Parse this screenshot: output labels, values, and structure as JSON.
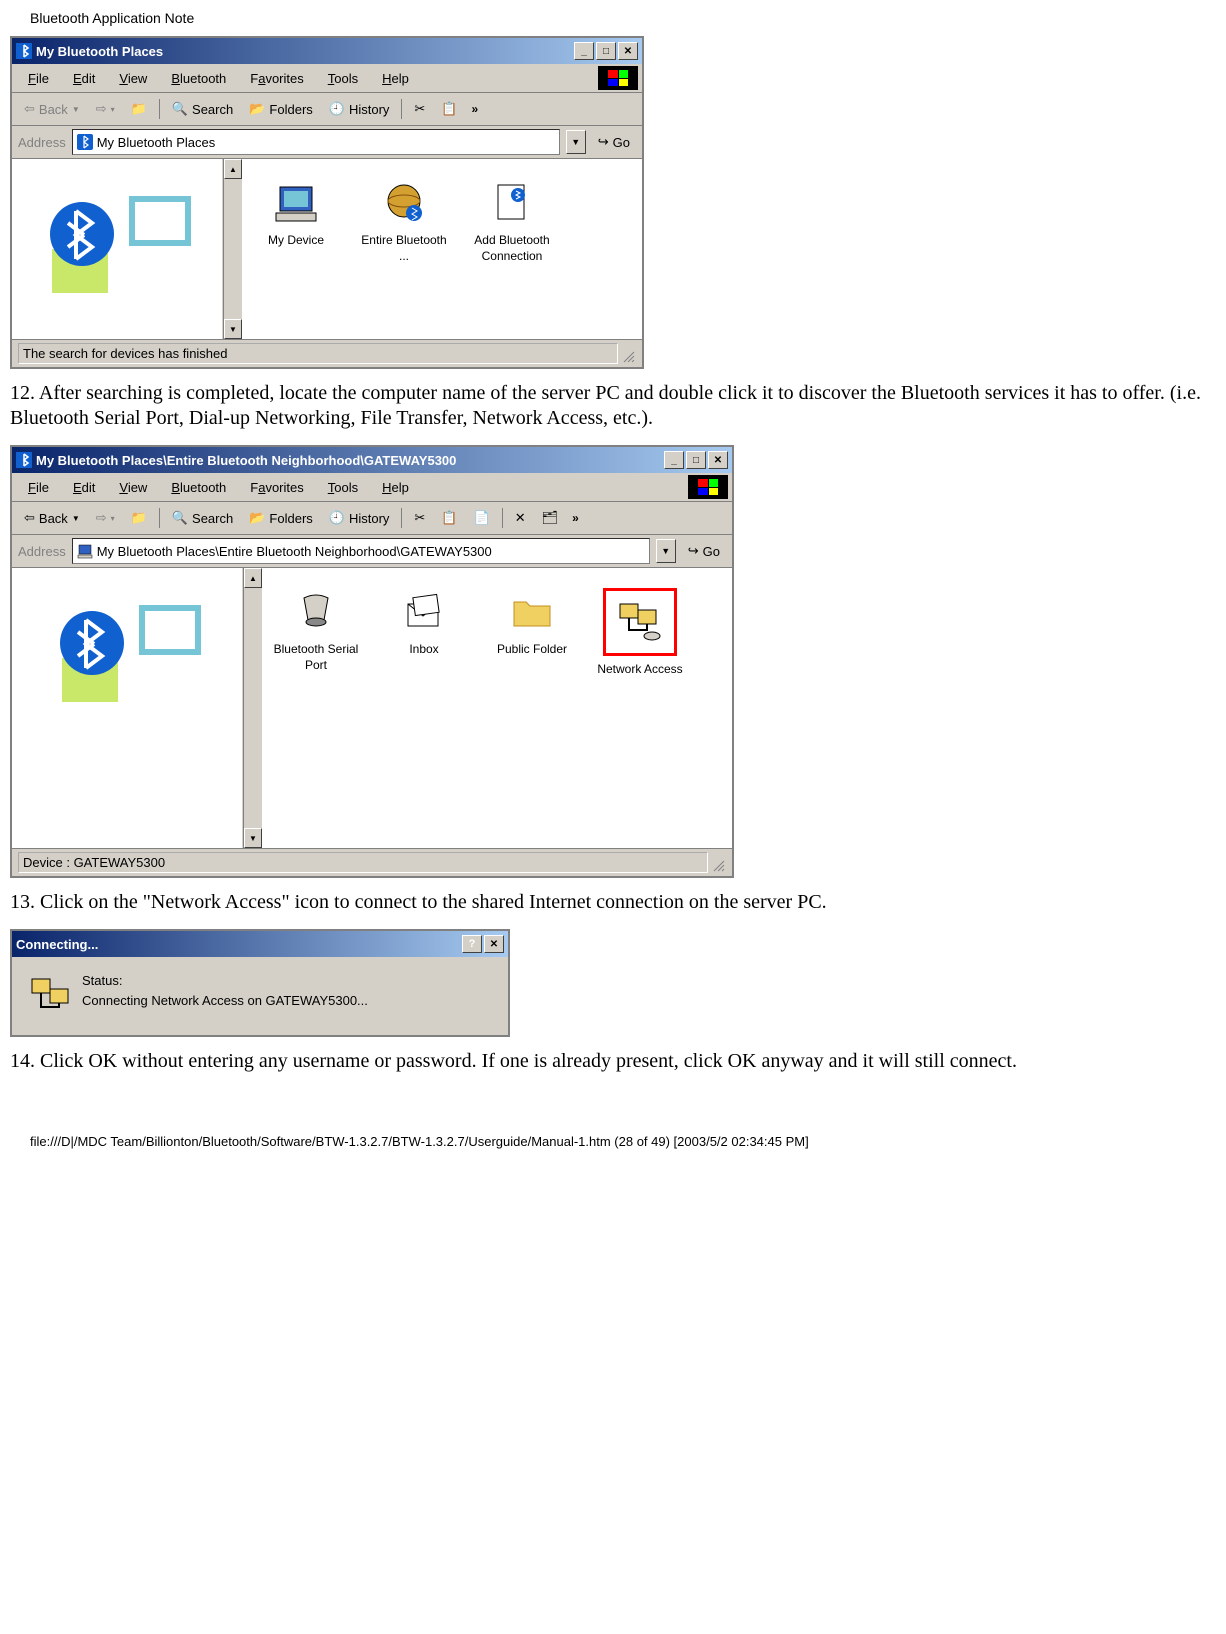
{
  "page_header": "Bluetooth Application Note",
  "win1": {
    "title": "My Bluetooth Places",
    "menus": [
      "File",
      "Edit",
      "View",
      "Bluetooth",
      "Favorites",
      "Tools",
      "Help"
    ],
    "back": "Back",
    "search": "Search",
    "folders": "Folders",
    "history": "History",
    "addr_label": "Address",
    "addr_value": "My Bluetooth Places",
    "go": "Go",
    "icons": [
      "My Device",
      "Entire Bluetooth ...",
      "Add Bluetooth Connection"
    ],
    "status": "The search for devices has finished"
  },
  "step12": "12. After searching is completed, locate the computer name of the server PC and double click it to discover the Bluetooth services it has to offer. (i.e. Bluetooth Serial Port, Dial-up Networking, File Transfer, Network Access, etc.).",
  "win2": {
    "title": "My Bluetooth Places\\Entire Bluetooth Neighborhood\\GATEWAY5300",
    "menus": [
      "File",
      "Edit",
      "View",
      "Bluetooth",
      "Favorites",
      "Tools",
      "Help"
    ],
    "back": "Back",
    "search": "Search",
    "folders": "Folders",
    "history": "History",
    "addr_label": "Address",
    "addr_value": "My Bluetooth Places\\Entire Bluetooth Neighborhood\\GATEWAY5300",
    "go": "Go",
    "icons": [
      "Bluetooth Serial Port",
      "Inbox",
      "Public Folder",
      "Network Access"
    ],
    "status": "Device : GATEWAY5300"
  },
  "step13": "13. Click on the \"Network Access\" icon to connect to the shared Internet connection on the server PC.",
  "win3": {
    "title": "Connecting...",
    "status_label": "Status:",
    "status_text": "Connecting Network Access on GATEWAY5300..."
  },
  "step14": "14. Click OK without entering any username or password. If one is already present, click OK anyway and it will still connect.",
  "footer": "file:///D|/MDC Team/Billionton/Bluetooth/Software/BTW-1.3.2.7/BTW-1.3.2.7/Userguide/Manual-1.htm (28 of 49) [2003/5/2 02:34:45 PM]"
}
